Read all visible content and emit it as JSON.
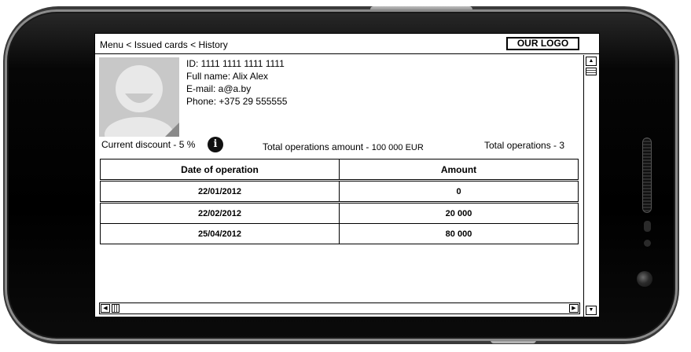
{
  "breadcrumb": {
    "items": [
      "Menu",
      "Issued cards",
      "History"
    ],
    "separator": " < "
  },
  "logo": {
    "text": "OUR LOGO"
  },
  "profile": {
    "id": "ID: 1111 1111 1111 1111",
    "full_name": "Full name: Alix Alex",
    "email": "E-mail: a@a.by",
    "phone": "Phone: +375 29 555555"
  },
  "stats": {
    "current_discount": "Current discount - 5 %",
    "total_amount_label": "Total operations amount - ",
    "total_amount_value": "100 000 EUR",
    "total_operations": "Total operations - 3"
  },
  "table": {
    "headers": {
      "date": "Date of operation",
      "amount": "Amount"
    },
    "rows": [
      {
        "date": "22/01/2012",
        "amount": "0"
      },
      {
        "date": "22/02/2012",
        "amount": "20 000"
      },
      {
        "date": "25/04/2012",
        "amount": "80 000"
      }
    ]
  },
  "icons": {
    "info": "info-icon",
    "avatar": "user-placeholder-icon",
    "scroll_up": "arrow-up-icon",
    "scroll_down": "arrow-down-icon",
    "scroll_left": "arrow-left-icon",
    "scroll_right": "arrow-right-icon"
  },
  "glyphs": {
    "info": "i",
    "up": "▲",
    "down": "▼",
    "left": "◀",
    "right": "▶"
  },
  "colors": {
    "frame": "#000000",
    "avatar_bg": "#c8c8c8",
    "screen_bg": "#ffffff"
  }
}
